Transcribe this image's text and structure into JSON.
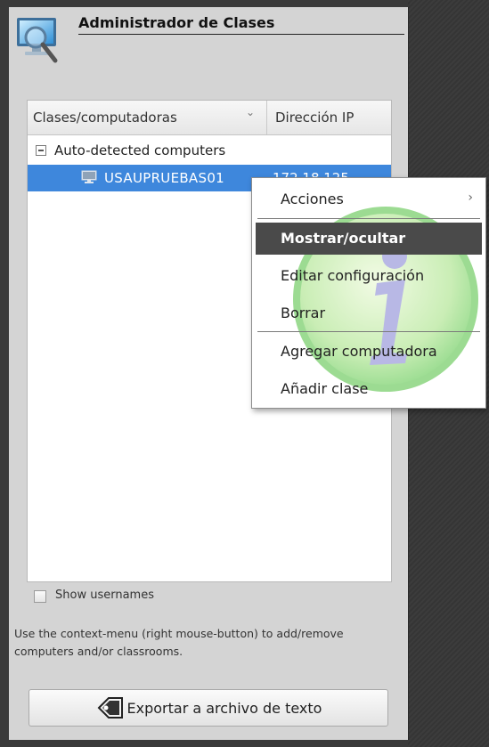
{
  "window": {
    "title": "Administrador de Clases"
  },
  "tree": {
    "columns": [
      "Clases/computadoras",
      "Dirección IP"
    ],
    "groups": [
      {
        "label": "Auto-detected computers",
        "computers": [
          {
            "name": "USAUPRUEBAS01",
            "ip": "172.18.125"
          }
        ]
      }
    ]
  },
  "context_menu": {
    "items": [
      {
        "label": "Acciones",
        "submenu": true
      },
      {
        "label": "Mostrar/ocultar",
        "highlighted": true
      },
      {
        "label": "Editar configuración"
      },
      {
        "label": "Borrar"
      },
      {
        "label": "Agregar computadora"
      },
      {
        "label": "Añadir clase"
      }
    ]
  },
  "options": {
    "show_usernames_label": "Show usernames",
    "show_usernames_checked": false
  },
  "help": {
    "text": "Use the context-menu (right mouse-button) to add/remove computers and/or classrooms."
  },
  "export_button": {
    "label": "Exportar a archivo de texto"
  },
  "icons": {
    "app": "monitor-magnifier-icon",
    "computer": "monitor-icon",
    "export": "tag-export-icon",
    "submenu": "chevron-right-icon",
    "expander": "collapse-minus-icon"
  },
  "colors": {
    "selection": "#3e87dc",
    "menu_highlight": "#4a4a4a",
    "panel_bg": "#d4d4d4"
  }
}
